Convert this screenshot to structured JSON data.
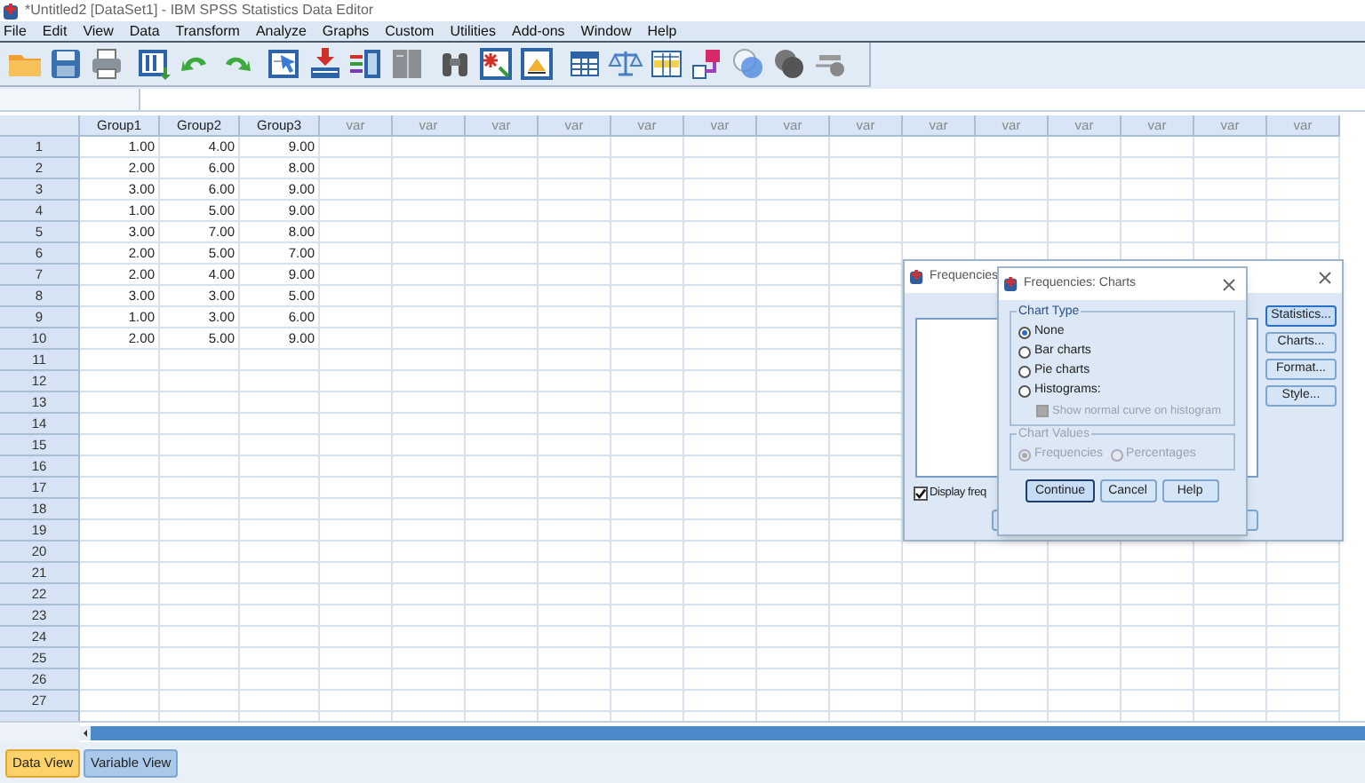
{
  "window": {
    "title": "*Untitled2 [DataSet1] - IBM SPSS Statistics Data Editor"
  },
  "menu": [
    "File",
    "Edit",
    "View",
    "Data",
    "Transform",
    "Analyze",
    "Graphs",
    "Custom",
    "Utilities",
    "Add-ons",
    "Window",
    "Help"
  ],
  "grid": {
    "columns": [
      {
        "label": "Group1",
        "kind": "variable"
      },
      {
        "label": "Group2",
        "kind": "variable"
      },
      {
        "label": "Group3",
        "kind": "variable"
      },
      {
        "label": "var",
        "kind": "empty"
      },
      {
        "label": "var",
        "kind": "empty"
      },
      {
        "label": "var",
        "kind": "empty"
      },
      {
        "label": "var",
        "kind": "empty"
      },
      {
        "label": "var",
        "kind": "empty"
      },
      {
        "label": "var",
        "kind": "empty"
      },
      {
        "label": "var",
        "kind": "empty"
      },
      {
        "label": "var",
        "kind": "empty"
      },
      {
        "label": "var",
        "kind": "empty"
      },
      {
        "label": "var",
        "kind": "empty"
      },
      {
        "label": "var",
        "kind": "empty"
      },
      {
        "label": "var",
        "kind": "empty"
      },
      {
        "label": "var",
        "kind": "empty"
      },
      {
        "label": "var",
        "kind": "empty"
      }
    ],
    "rows": [
      {
        "number": "1",
        "cells": [
          "1.00",
          "4.00",
          "9.00"
        ]
      },
      {
        "number": "2",
        "cells": [
          "2.00",
          "6.00",
          "8.00"
        ]
      },
      {
        "number": "3",
        "cells": [
          "3.00",
          "6.00",
          "9.00"
        ]
      },
      {
        "number": "4",
        "cells": [
          "1.00",
          "5.00",
          "9.00"
        ]
      },
      {
        "number": "5",
        "cells": [
          "3.00",
          "7.00",
          "8.00"
        ]
      },
      {
        "number": "6",
        "cells": [
          "2.00",
          "5.00",
          "7.00"
        ]
      },
      {
        "number": "7",
        "cells": [
          "2.00",
          "4.00",
          "9.00"
        ]
      },
      {
        "number": "8",
        "cells": [
          "3.00",
          "3.00",
          "5.00"
        ]
      },
      {
        "number": "9",
        "cells": [
          "1.00",
          "3.00",
          "6.00"
        ]
      },
      {
        "number": "10",
        "cells": [
          "2.00",
          "5.00",
          "9.00"
        ]
      },
      {
        "number": "11",
        "cells": []
      },
      {
        "number": "12",
        "cells": []
      },
      {
        "number": "13",
        "cells": []
      },
      {
        "number": "14",
        "cells": []
      },
      {
        "number": "15",
        "cells": []
      },
      {
        "number": "16",
        "cells": []
      },
      {
        "number": "17",
        "cells": []
      },
      {
        "number": "18",
        "cells": []
      },
      {
        "number": "19",
        "cells": []
      },
      {
        "number": "20",
        "cells": []
      },
      {
        "number": "21",
        "cells": []
      },
      {
        "number": "22",
        "cells": []
      },
      {
        "number": "23",
        "cells": []
      },
      {
        "number": "24",
        "cells": []
      },
      {
        "number": "25",
        "cells": []
      },
      {
        "number": "26",
        "cells": []
      },
      {
        "number": "27",
        "cells": []
      }
    ]
  },
  "view_tabs": [
    {
      "label": "Data View",
      "selected": true
    },
    {
      "label": "Variable View",
      "selected": false
    }
  ],
  "frequencies_dialog": {
    "title": "Frequencies",
    "buttons": [
      "Statistics...",
      "Charts...",
      "Format...",
      "Style..."
    ],
    "display_checkbox": {
      "label": "Display freq",
      "checked": true
    }
  },
  "charts_dialog": {
    "title": "Frequencies: Charts",
    "chart_type": {
      "legend": "Chart Type",
      "options": [
        {
          "label": "None",
          "selected": true
        },
        {
          "label": "Bar charts",
          "selected": false
        },
        {
          "label": "Pie charts",
          "selected": false
        },
        {
          "label": "Histograms:",
          "selected": false
        }
      ],
      "normal_curve": {
        "label": "Show normal curve on histogram",
        "checked": false,
        "disabled": true
      }
    },
    "chart_values": {
      "legend": "Chart Values",
      "disabled": true,
      "options": [
        {
          "label": "Frequencies",
          "selected": true
        },
        {
          "label": "Percentages",
          "selected": false
        }
      ]
    },
    "buttons": [
      "Continue",
      "Cancel",
      "Help"
    ]
  }
}
